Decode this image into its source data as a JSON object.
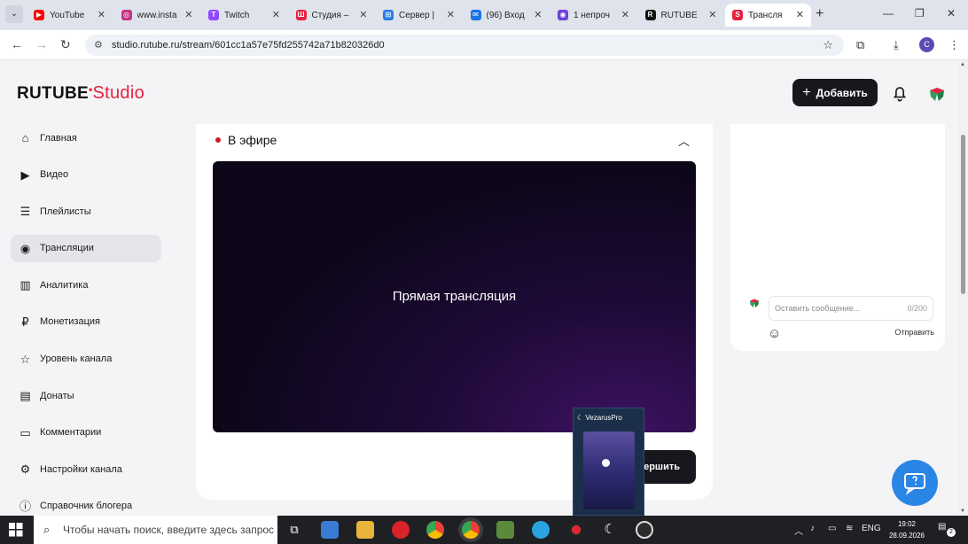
{
  "browser": {
    "tabs": [
      {
        "label": "YouTube",
        "color": "#ff0000",
        "glyph": "▶"
      },
      {
        "label": "www.insta",
        "color": "#c13584",
        "glyph": "◎"
      },
      {
        "label": "Twitch",
        "color": "#9146ff",
        "glyph": "T"
      },
      {
        "label": "Студия –",
        "color": "#e8213f",
        "glyph": "Ш"
      },
      {
        "label": "Сервер |",
        "color": "#2a7be4",
        "glyph": "⊞"
      },
      {
        "label": "(96) Вход",
        "color": "#1a73e8",
        "glyph": "✉"
      },
      {
        "label": "1 непроч",
        "color": "#6c3fd8",
        "glyph": "◉"
      },
      {
        "label": "RUTUBE",
        "color": "#111111",
        "glyph": "R"
      },
      {
        "label": "Трансля",
        "color": "#e8213f",
        "glyph": "S"
      }
    ],
    "url": "studio.rutube.ru/stream/601cc1a57e75fd255742a71b820326d0",
    "profile_letter": "C"
  },
  "header": {
    "logo_text": "RUTUBE",
    "logo_suffix": "Studio",
    "add_button": "Добавить"
  },
  "sidebar": {
    "items": [
      {
        "label": "Главная",
        "icon": "home-icon"
      },
      {
        "label": "Видео",
        "icon": "video-icon"
      },
      {
        "label": "Плейлисты",
        "icon": "playlist-icon"
      },
      {
        "label": "Трансляции",
        "icon": "broadcast-icon",
        "active": true
      },
      {
        "label": "Аналитика",
        "icon": "analytics-icon"
      },
      {
        "label": "Монетизация",
        "icon": "monetization-icon"
      },
      {
        "label": "Уровень канала",
        "icon": "star-icon"
      },
      {
        "label": "Донаты",
        "icon": "donate-icon"
      },
      {
        "label": "Комментарии",
        "icon": "comments-icon"
      },
      {
        "label": "Настройки канала",
        "icon": "settings-icon"
      },
      {
        "label": "Справочник блогера",
        "icon": "info-icon"
      }
    ]
  },
  "stream": {
    "status": "В эфире",
    "player_text": "Прямая трансляция",
    "finish_button": "ершить"
  },
  "chat": {
    "placeholder": "Оставить сообщение...",
    "counter": "0/200",
    "send": "Отправить"
  },
  "popup": {
    "title": "VezarusPro"
  },
  "taskbar": {
    "search_placeholder": "Чтобы начать поиск, введите здесь запрос",
    "language": "ENG",
    "time": "19:02",
    "date": "28.09.2026",
    "notifications": "2"
  },
  "colors": {
    "accent": "#e8213f",
    "dark_button": "#17181d",
    "support": "#2a86e5"
  }
}
